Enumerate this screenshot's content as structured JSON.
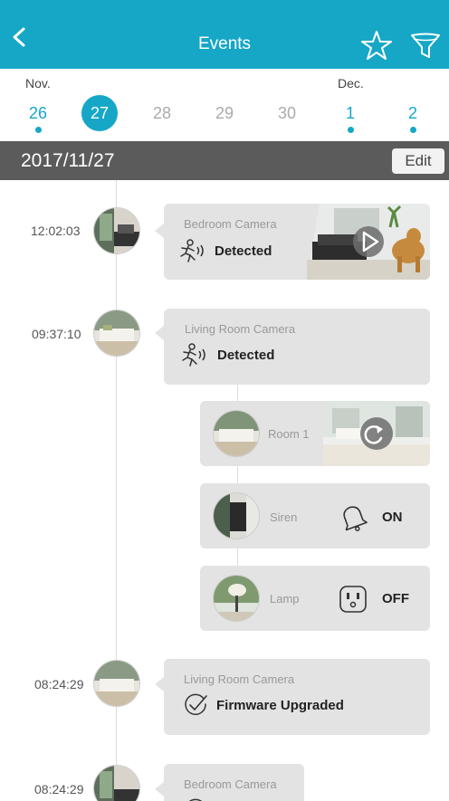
{
  "header": {
    "title": "Events",
    "back_icon": "chevron-left-icon",
    "favorite_icon": "star-icon",
    "filter_icon": "filter-icon",
    "bg_color": "#16a7c7"
  },
  "dates": {
    "months": [
      "Nov.",
      "Dec."
    ],
    "days": [
      {
        "label": "26",
        "has_events": true,
        "selected": false
      },
      {
        "label": "27",
        "has_events": true,
        "selected": true
      },
      {
        "label": "28",
        "has_events": false,
        "selected": false
      },
      {
        "label": "29",
        "has_events": false,
        "selected": false
      },
      {
        "label": "30",
        "has_events": false,
        "selected": false
      },
      {
        "label": "1",
        "has_events": true,
        "selected": false
      },
      {
        "label": "2",
        "has_events": true,
        "selected": false
      }
    ]
  },
  "datebar": {
    "date": "2017/11/27",
    "edit_label": "Edit"
  },
  "events": [
    {
      "time": "12:02:03",
      "camera": "Bedroom Camera",
      "status": "Detected",
      "icon": "motion-icon",
      "has_video": true
    },
    {
      "time": "09:37:10",
      "camera": "Living Room Camera",
      "status": "Detected",
      "icon": "motion-icon"
    },
    {
      "time": "08:24:29",
      "camera": "Living Room Camera",
      "status": "Firmware Upgraded",
      "icon": "check-circle-icon"
    },
    {
      "time": "08:24:29",
      "camera": "Bedroom Camera",
      "status": "",
      "icon": "check-circle-icon"
    }
  ],
  "sub_events": [
    {
      "label": "Room 1",
      "icon": "refresh-icon"
    },
    {
      "label": "Siren",
      "icon": "bell-icon",
      "value": "ON"
    },
    {
      "label": "Lamp",
      "icon": "plug-icon",
      "value": "OFF"
    }
  ]
}
